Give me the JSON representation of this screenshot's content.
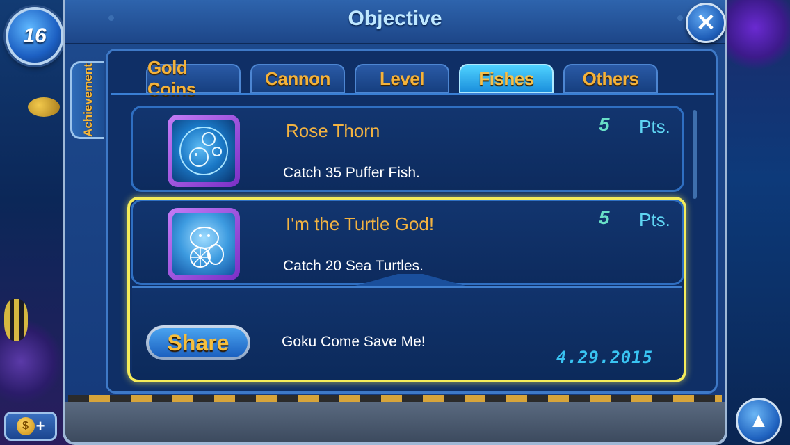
{
  "player": {
    "level": "16"
  },
  "window": {
    "title": "Objective",
    "close_icon": "close-icon"
  },
  "side_tab": {
    "label": "Achievement"
  },
  "tabs": [
    {
      "label": "Gold Coins",
      "active": false
    },
    {
      "label": "Cannon",
      "active": false
    },
    {
      "label": "Level",
      "active": false
    },
    {
      "label": "Fishes",
      "active": true
    },
    {
      "label": "Others",
      "active": false
    }
  ],
  "achievements": [
    {
      "title": "Rose Thorn",
      "description": "Catch 35 Puffer Fish.",
      "points": "5",
      "points_label": "Pts.",
      "icon": "puffer-fish-icon"
    },
    {
      "title": "I'm the Turtle God!",
      "description": "Catch 20 Sea Turtles.",
      "points": "5",
      "points_label": "Pts.",
      "icon": "turtle-icon",
      "selected": true
    }
  ],
  "share": {
    "button_label": "Share",
    "message": "Goku Come Save Me!",
    "date": "4.29.2015"
  },
  "colors": {
    "highlight": "#f4ec5a",
    "tab_text": "#f4b23a",
    "active_tab": "#4fd2ff",
    "points": "#69e0c7"
  }
}
